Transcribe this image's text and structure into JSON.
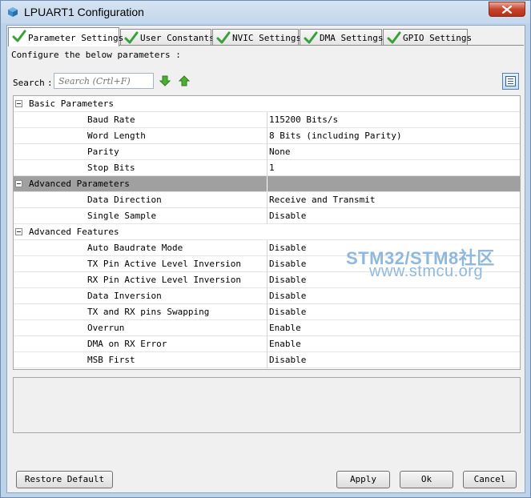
{
  "window": {
    "title": "LPUART1 Configuration"
  },
  "tabs": [
    {
      "label": "Parameter Settings",
      "active": true
    },
    {
      "label": "User Constants",
      "active": false
    },
    {
      "label": "NVIC Settings",
      "active": false
    },
    {
      "label": "DMA Settings",
      "active": false
    },
    {
      "label": "GPIO Settings",
      "active": false
    }
  ],
  "panel": {
    "hint": "Configure the below parameters :",
    "search_label": "Search",
    "search_colon": ":",
    "search_placeholder": "Search (Crtl+F)"
  },
  "groups": [
    {
      "label": "Basic Parameters",
      "params": [
        {
          "name": "Baud Rate",
          "value": "115200 Bits/s"
        },
        {
          "name": "Word Length",
          "value": "8 Bits (including Parity)"
        },
        {
          "name": "Parity",
          "value": "None"
        },
        {
          "name": "Stop Bits",
          "value": "1"
        }
      ]
    },
    {
      "label": "Advanced Parameters",
      "selected": true,
      "params": [
        {
          "name": "Data Direction",
          "value": "Receive and Transmit"
        },
        {
          "name": "Single Sample",
          "value": "Disable"
        }
      ]
    },
    {
      "label": "Advanced Features",
      "params": [
        {
          "name": "Auto Baudrate Mode",
          "value": "Disable"
        },
        {
          "name": "TX Pin Active Level Inversion",
          "value": "Disable"
        },
        {
          "name": "RX Pin Active Level Inversion",
          "value": "Disable"
        },
        {
          "name": "Data Inversion",
          "value": "Disable"
        },
        {
          "name": "TX and RX pins Swapping",
          "value": "Disable"
        },
        {
          "name": "Overrun",
          "value": "Enable"
        },
        {
          "name": "DMA on RX Error",
          "value": "Enable"
        },
        {
          "name": "MSB First",
          "value": "Disable"
        }
      ]
    }
  ],
  "watermark": {
    "line1": "STM32/STM8社区",
    "line2": "www.stmcu.org"
  },
  "buttons": {
    "restore": "Restore Default",
    "apply": "Apply",
    "ok": "Ok",
    "cancel": "Cancel"
  },
  "colors": {
    "selected_row": "#a0a0a0",
    "check_green": "#3aa13a",
    "watermark": "#8fb8de"
  },
  "icons": {
    "app": "cube-icon",
    "close": "close-icon",
    "tab_check": "check-icon",
    "search_down": "arrow-down-icon",
    "search_up": "arrow-up-icon",
    "view_toggle": "list-view-icon",
    "group_toggle": "collapse-icon"
  }
}
